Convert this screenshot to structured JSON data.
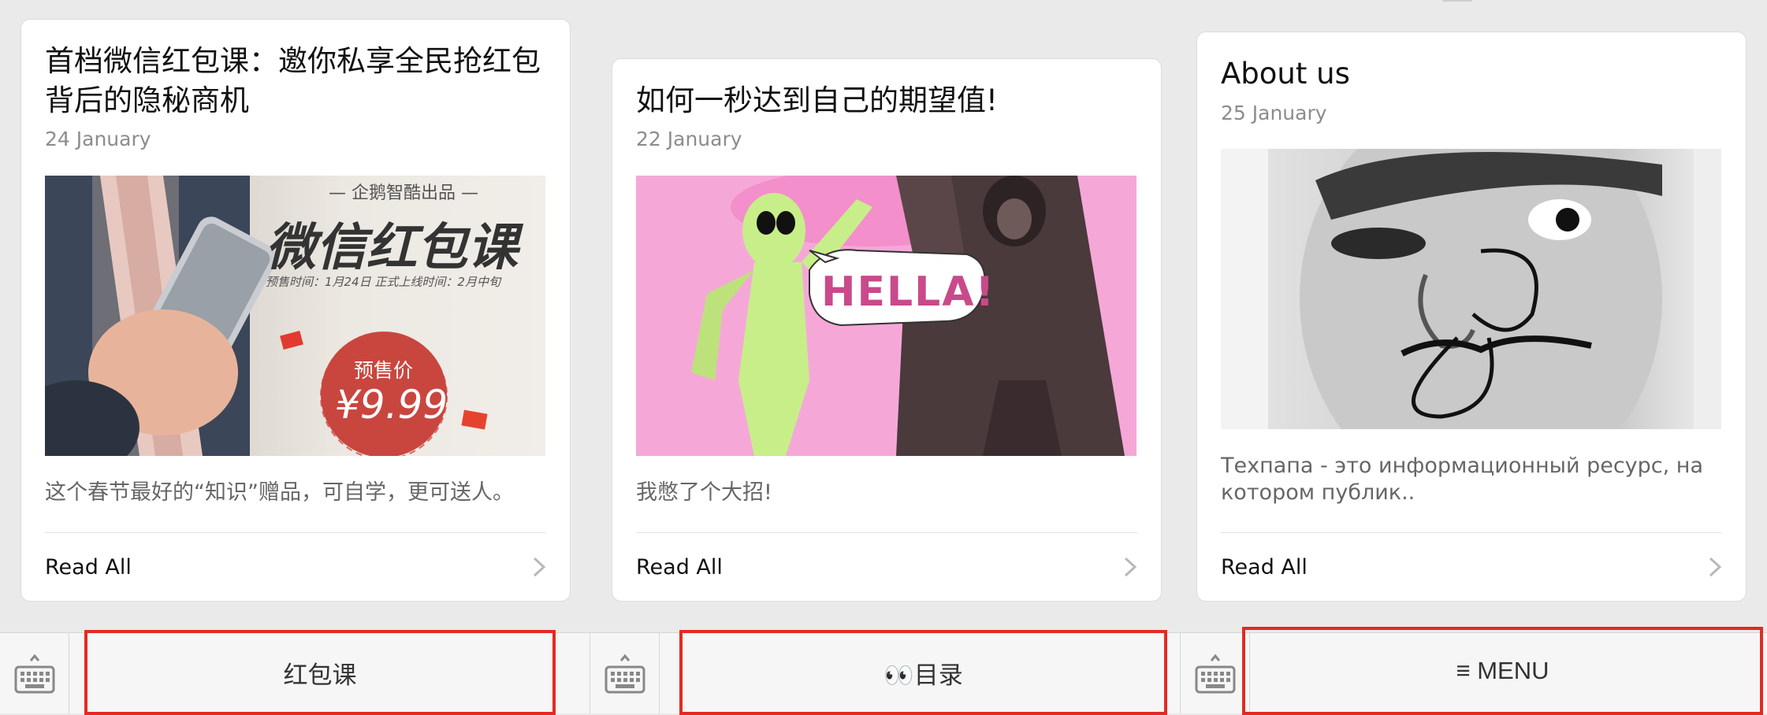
{
  "cards": [
    {
      "title": "首档微信红包课：邀你私享全民抢红包背后的隐秘商机",
      "date": "24 January",
      "image": {
        "brand": "— 企鹅智酷出品 —",
        "headline": "微信红包课",
        "schedule": "预售时间：1月24日  正式上线时间：2月中旬",
        "price_label": "预售价",
        "price": "¥9.99"
      },
      "description": "这个春节最好的“知识”赠品，可自学，更可送人。",
      "read_all": "Read All"
    },
    {
      "title": "如何一秒达到自己的期望值!",
      "date": "22 January",
      "image": {
        "speech": "HELLA!"
      },
      "description": "我憋了个大招!",
      "read_all": "Read All"
    },
    {
      "title": "About us",
      "date": "25 January",
      "image": {},
      "description": "Техпапа - это информационный ресурс, на котором публик..",
      "read_all": "Read All"
    }
  ],
  "bottom_menu": [
    {
      "icon": "keyboard-icon",
      "label": "红包课"
    },
    {
      "icon": "keyboard-icon",
      "label": "👀目录"
    },
    {
      "icon": "keyboard-icon",
      "label": "≡ MENU"
    }
  ],
  "colors": {
    "highlight_border": "#e32a22",
    "background": "#eaeaea",
    "card": "#ffffff",
    "muted_text": "#8c8c8c"
  }
}
